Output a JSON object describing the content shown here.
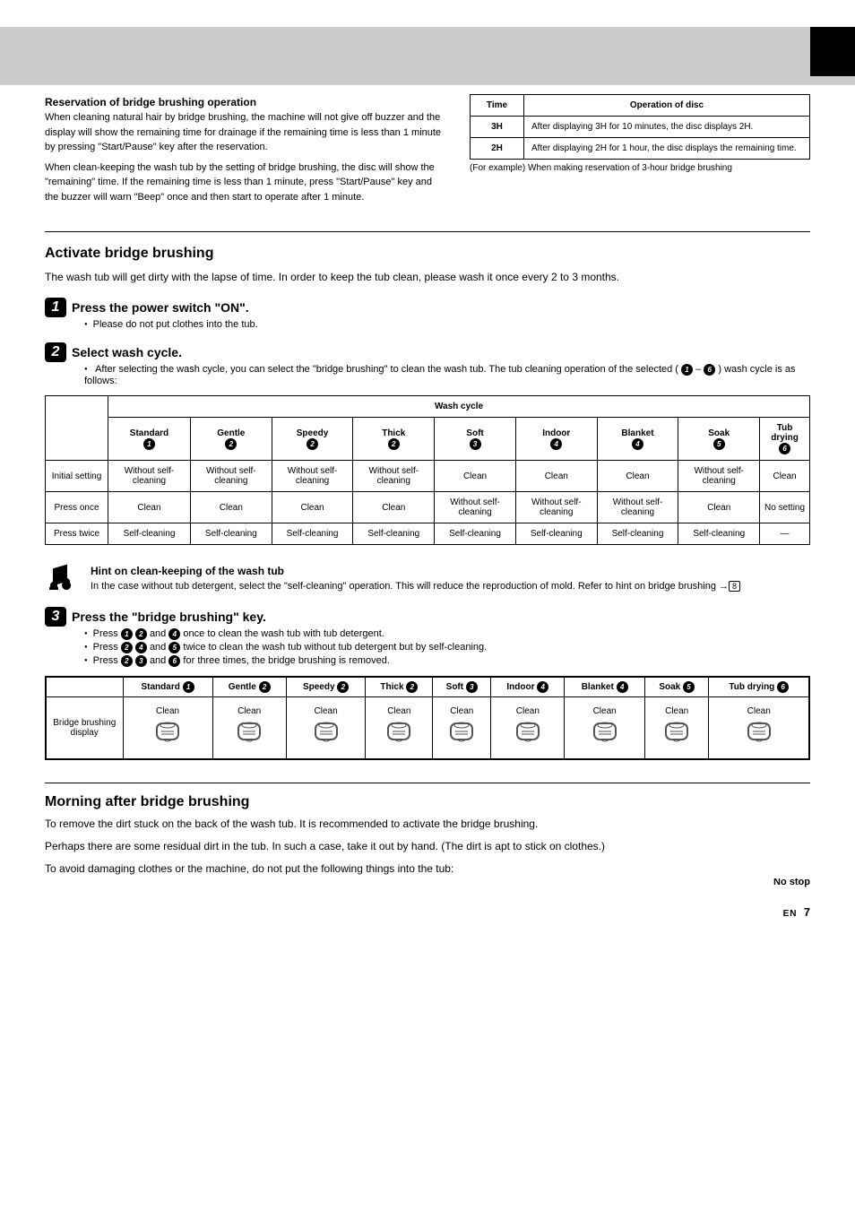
{
  "top": {
    "left": {
      "heading": "Reservation of bridge brushing operation",
      "body": "When cleaning natural hair by bridge brushing, the machine will not give off buzzer and the display will show the remaining time for drainage if the remaining time is less than 1 minute by pressing \"Start/Pause\" key after the reservation.",
      "body2": "When clean-keeping the wash tub by the setting of bridge brushing, the disc will show the \"remaining\" time. If the remaining time is less than 1 minute, press \"Start/Pause\" key and the buzzer will warn \"Beep\" once and then start to operate after 1 minute."
    },
    "table": {
      "head": {
        "c1": "Time",
        "c2": "Operation of disc"
      },
      "rows": [
        {
          "c1": "3H",
          "c2": "After displaying 3H for 10 minutes, the disc displays 2H."
        },
        {
          "c1": "2H",
          "c2": "After displaying 2H for 1 hour, the disc displays the remaining time."
        }
      ],
      "note": "(For example) When making reservation of 3-hour bridge brushing"
    }
  },
  "activate": {
    "heading": "Activate bridge brushing",
    "intro": "The wash tub will get dirty with the lapse of time. In order to keep the tub clean, please wash it once every 2 to 3 months.",
    "steps": [
      {
        "num": "1",
        "text": "Press the power switch \"ON\".",
        "bullet": "Please do not put clothes into the tub."
      },
      {
        "num": "2",
        "text": "Select wash cycle.",
        "bullet_prefix": "After selecting the wash cycle, you can select the \"bridge brushing\" to clean the wash tub. The tub cleaning operation of the selected (",
        "c1": "1",
        "to": " – ",
        "c2": "6",
        "bullet_suffix": ") wash cycle is as follows:"
      },
      {
        "num": "3",
        "text": "Press the \"bridge brushing\" key.",
        "bullets": [
          {
            "pre": "Press",
            "a": "1",
            "b": "2",
            "mid": "and",
            "c": "4",
            "post": "once to clean the wash tub with tub detergent."
          },
          {
            "pre": "Press",
            "a": "2",
            "b": "4",
            "mid": "and",
            "c": "5",
            "post": "twice to clean the wash tub without tub detergent but by self-cleaning."
          },
          {
            "pre": "Press",
            "a": "2",
            "b": "3",
            "mid": "and",
            "c": "6",
            "post": "for three times, the bridge brushing is removed."
          }
        ]
      }
    ]
  },
  "washtable": {
    "cycle_head": "Wash cycle",
    "cols": [
      {
        "name": "Standard",
        "num": "1"
      },
      {
        "name": "Gentle",
        "num": "2"
      },
      {
        "name": "Speedy",
        "num": "2"
      },
      {
        "name": "Thick",
        "num": "2"
      },
      {
        "name": "Soft",
        "num": "3"
      },
      {
        "name": "Indoor",
        "num": "4"
      },
      {
        "name": "Blanket",
        "num": "4"
      },
      {
        "name": "Soak",
        "num": "5"
      },
      {
        "name": "Tub drying",
        "num": "6"
      }
    ],
    "rows": [
      {
        "label": "Initial setting",
        "vals": [
          "Without self-cleaning",
          "Without self-cleaning",
          "Without self-cleaning",
          "Without self-cleaning",
          "Clean",
          "Clean",
          "Clean",
          "Without self-cleaning",
          "Clean"
        ]
      },
      {
        "label": "Press once",
        "vals": [
          "Clean",
          "Clean",
          "Clean",
          "Clean",
          "Without self-cleaning",
          "Without self-cleaning",
          "Without self-cleaning",
          "Clean",
          "No setting"
        ]
      },
      {
        "label": "Press twice",
        "vals": [
          "Self-cleaning",
          "Self-cleaning",
          "Self-cleaning",
          "Self-cleaning",
          "Self-cleaning",
          "Self-cleaning",
          "Self-cleaning",
          "Self-cleaning",
          "—"
        ]
      }
    ]
  },
  "hint": {
    "heading": "Hint on clean-keeping of the wash tub",
    "body": "In the case without tub detergent, select the \"self-cleaning\" operation. This will reduce the reproduction of mold. Refer to hint on bridge brushing ",
    "page": "8"
  },
  "bridge": {
    "row_label": "",
    "row_label2": "Bridge brushing display",
    "cols": [
      {
        "name": "Standard",
        "num": "1"
      },
      {
        "name": "Gentle",
        "num": "2"
      },
      {
        "name": "Speedy",
        "num": "2"
      },
      {
        "name": "Thick",
        "num": "2"
      },
      {
        "name": "Soft",
        "num": "3"
      },
      {
        "name": "Indoor",
        "num": "4"
      },
      {
        "name": "Blanket",
        "num": "4"
      },
      {
        "name": "Soak",
        "num": "5"
      },
      {
        "name": "Tub drying",
        "num": "6"
      }
    ],
    "vals": [
      "Clean",
      "Clean",
      "Clean",
      "Clean",
      "Clean",
      "Clean",
      "Clean",
      "Clean",
      "Clean"
    ]
  },
  "morning": {
    "heading": "Morning after bridge brushing",
    "p1": "To remove the dirt stuck on the back of the wash tub. It is recommended to activate the bridge brushing.",
    "p2": "Perhaps there are some residual dirt in the tub. In such a case, take it out by hand. (The dirt is apt to stick on clothes.)",
    "p3": "To avoid damaging clothes or the machine, do not put the following things into the tub:",
    "nostop": "No stop"
  },
  "footer": {
    "lang": "EN",
    "page": "7"
  }
}
